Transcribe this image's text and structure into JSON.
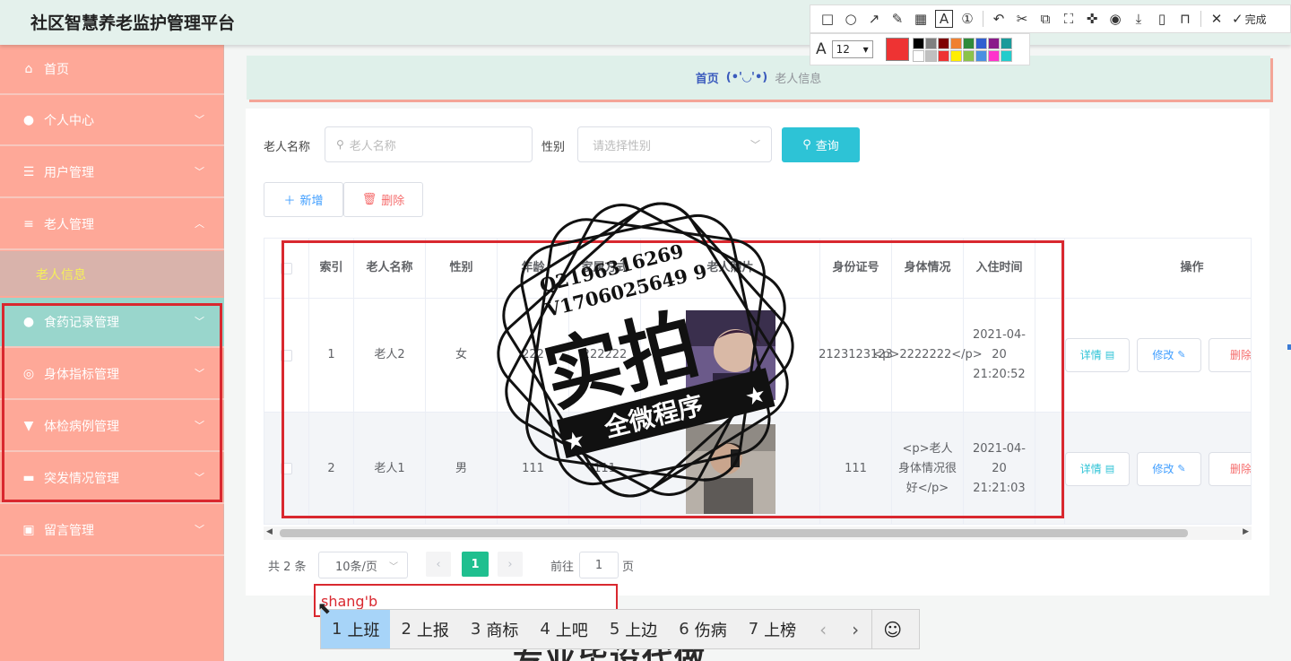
{
  "app": {
    "title": "社区智慧养老监护管理平台"
  },
  "toolbar": {
    "tools": [
      {
        "icon": "rectangle-icon",
        "glyph": "□"
      },
      {
        "icon": "circle-icon",
        "glyph": "○"
      },
      {
        "icon": "arrow-icon",
        "glyph": "↗"
      },
      {
        "icon": "pen-icon",
        "glyph": "✎"
      },
      {
        "icon": "mosaic-icon",
        "glyph": "▦"
      },
      {
        "icon": "text-icon",
        "glyph": "A"
      },
      {
        "icon": "number-icon",
        "glyph": "①"
      },
      {
        "icon": "undo-icon",
        "glyph": "↶"
      },
      {
        "icon": "scissors-icon",
        "glyph": "✂"
      },
      {
        "icon": "translate-icon",
        "glyph": "⧉"
      },
      {
        "icon": "ocr-icon",
        "glyph": "⛶"
      },
      {
        "icon": "pin-icon",
        "glyph": "✜"
      },
      {
        "icon": "record-icon",
        "glyph": "◉"
      },
      {
        "icon": "download-icon",
        "glyph": "⤓"
      },
      {
        "icon": "phone-icon",
        "glyph": "▯"
      },
      {
        "icon": "bookmark-icon",
        "glyph": "⊓"
      },
      {
        "icon": "close-icon",
        "glyph": "✕"
      }
    ],
    "done_label": "完成",
    "font_size": "12",
    "current_color": "#ee3333",
    "palette": [
      "#000000",
      "#808080",
      "#800000",
      "#f08030",
      "#2e8b3a",
      "#2f5fd0",
      "#8a1a8a",
      "#1a9a9a",
      "#ffffff",
      "#c0c0c0",
      "#ee3333",
      "#ffee00",
      "#8bc34a",
      "#4a90e2",
      "#ff33cc",
      "#22cccc"
    ]
  },
  "sidebar": {
    "items": [
      {
        "label": "首页",
        "icon": "home-icon",
        "glyph": "⌂",
        "chevron": ""
      },
      {
        "label": "个人中心",
        "icon": "user-icon",
        "glyph": "●",
        "chevron": "﹀"
      },
      {
        "label": "用户管理",
        "icon": "sliders-icon",
        "glyph": "☰",
        "chevron": "﹀"
      },
      {
        "label": "老人管理",
        "icon": "list-icon",
        "glyph": "≡",
        "chevron": "︿"
      },
      {
        "label": "食药记录管理",
        "icon": "user-icon",
        "glyph": "●",
        "chevron": "﹀"
      },
      {
        "label": "身体指标管理",
        "icon": "lifebuoy-icon",
        "glyph": "◎",
        "chevron": "﹀"
      },
      {
        "label": "体检病例管理",
        "icon": "stamp-icon",
        "glyph": "▼",
        "chevron": "﹀"
      },
      {
        "label": "突发情况管理",
        "icon": "briefcase-icon",
        "glyph": "▬",
        "chevron": "﹀"
      },
      {
        "label": "留言管理",
        "icon": "clipboard-icon",
        "glyph": "▣",
        "chevron": "﹀"
      }
    ],
    "submenu_label": "老人信息"
  },
  "breadcrumb": {
    "home": "首页",
    "separator": "(•'◡'•)",
    "current": "老人信息"
  },
  "search": {
    "name_label": "老人名称",
    "name_placeholder": "老人名称",
    "sex_label": "性别",
    "sex_placeholder": "请选择性别",
    "query_label": "查询"
  },
  "actions": {
    "add_label": "新增",
    "delete_label": "删除"
  },
  "table": {
    "headers": [
      "",
      "索引",
      "老人名称",
      "性别",
      "年龄",
      "家属方式",
      "老人照片",
      "身份证号",
      "身体情况",
      "入住时间",
      "",
      "操作"
    ],
    "rows": [
      {
        "index": "1",
        "name": "老人2",
        "sex": "女",
        "age": "222",
        "family": "222222",
        "id": "2123123123",
        "body": "<p>2222222</p>",
        "time": "2021-04-20 21:20:52"
      },
      {
        "index": "2",
        "name": "老人1",
        "sex": "男",
        "age": "111",
        "family": "111",
        "id": "111",
        "body": "<p>老人身体情况很好</p>",
        "time": "2021-04-20 21:21:03"
      }
    ],
    "op_detail": "详情",
    "op_edit": "修改",
    "op_delete": "删除"
  },
  "pagination": {
    "total": "共 2 条",
    "page_size": "10条/页",
    "current_page": "1",
    "goto_label": "前往",
    "goto_value": "1",
    "page_suffix": "页"
  },
  "stamp": {
    "line1": "Q2196316269",
    "line2": "V1706025649 9",
    "main": "实拍",
    "ribbon": "全微程序"
  },
  "ime": {
    "composition": "shang'b",
    "candidates": [
      {
        "n": "1",
        "text": "上班"
      },
      {
        "n": "2",
        "text": "上报"
      },
      {
        "n": "3",
        "text": "商标"
      },
      {
        "n": "4",
        "text": "上吧"
      },
      {
        "n": "5",
        "text": "上边"
      },
      {
        "n": "6",
        "text": "伤病"
      },
      {
        "n": "7",
        "text": "上榜"
      }
    ],
    "emoji_glyph": "☺"
  },
  "overlay_text": "专业毕设代做"
}
